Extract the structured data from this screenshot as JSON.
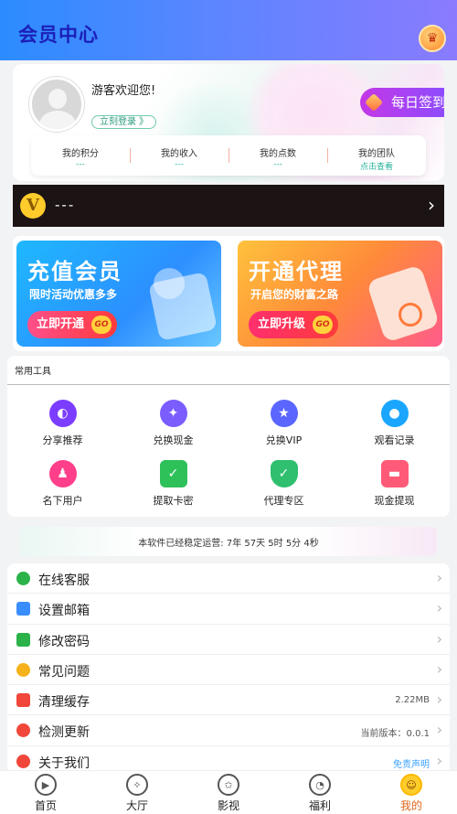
{
  "header": {
    "title": "会员中心",
    "crown_icon": "crown-icon"
  },
  "profile": {
    "welcome": "游客欢迎您!",
    "login_label": "立刻登录 》",
    "signin_label": "每日签到",
    "stats": [
      {
        "label": "我的积分",
        "value": "---"
      },
      {
        "label": "我的收入",
        "value": "---"
      },
      {
        "label": "我的点数",
        "value": "---"
      },
      {
        "label": "我的团队",
        "value": "点击查看"
      }
    ]
  },
  "vip": {
    "badge": "V",
    "text": "---",
    "arrow": "›"
  },
  "promos": [
    {
      "title": "充值会员",
      "subtitle": "限时活动优惠多多",
      "button": "立即开通",
      "go": "GO"
    },
    {
      "title": "开通代理",
      "subtitle": "开启您的财富之路",
      "button": "立即升级",
      "go": "GO"
    }
  ],
  "tools": {
    "title": "常用工具",
    "items": [
      {
        "label": "分享推荐",
        "icon": "share-icon",
        "color": "#7b3dff"
      },
      {
        "label": "兑换现金",
        "icon": "fish-icon",
        "color": "#7b5cff"
      },
      {
        "label": "兑换VIP",
        "icon": "star-icon",
        "color": "#5a66ff"
      },
      {
        "label": "观看记录",
        "icon": "camera-icon",
        "color": "#1aa6ff"
      },
      {
        "label": "名下用户",
        "icon": "user-icon",
        "color": "#ff3f8a"
      },
      {
        "label": "提取卡密",
        "icon": "bag-icon",
        "color": "#2ec15a"
      },
      {
        "label": "代理专区",
        "icon": "shield-icon",
        "color": "#2fbf6e"
      },
      {
        "label": "现金提现",
        "icon": "card-icon",
        "color": "#ff5a78"
      }
    ]
  },
  "runtime": {
    "text": "本软件已经稳定运营: 7年 57天 5时 5分 4秒"
  },
  "menu": [
    {
      "label": "在线客服",
      "icon": "wechat-icon",
      "color": "#2bb34a",
      "right": ""
    },
    {
      "label": "设置邮箱",
      "icon": "mail-icon",
      "color": "#3a8dff",
      "right": ""
    },
    {
      "label": "修改密码",
      "icon": "lock-icon",
      "color": "#2bb34a",
      "right": ""
    },
    {
      "label": "常见问题",
      "icon": "question-icon",
      "color": "#f6b21b",
      "right": ""
    },
    {
      "label": "清理缓存",
      "icon": "trash-icon",
      "color": "#f0473a",
      "right": "2.22MB"
    },
    {
      "label": "检测更新",
      "icon": "download-icon",
      "color": "#f0473a",
      "right": "当前版本：0.0.1"
    },
    {
      "label": "关于我们",
      "icon": "about-icon",
      "color": "#f0473a",
      "right": "免责声明"
    }
  ],
  "tabs": [
    {
      "label": "首页",
      "icon": "play-icon"
    },
    {
      "label": "大厅",
      "icon": "compass-icon"
    },
    {
      "label": "影视",
      "icon": "film-icon"
    },
    {
      "label": "福利",
      "icon": "pacman-icon"
    },
    {
      "label": "我的",
      "icon": "smile-icon"
    }
  ]
}
